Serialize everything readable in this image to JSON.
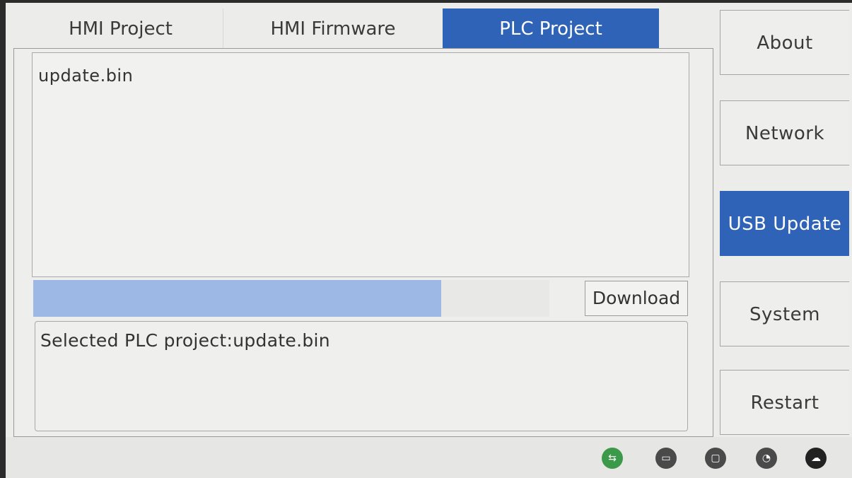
{
  "tabs": [
    {
      "label": "HMI Project",
      "active": false
    },
    {
      "label": "HMI Firmware",
      "active": false
    },
    {
      "label": "PLC Project",
      "active": true
    }
  ],
  "file_list": {
    "items": [
      "update.bin"
    ]
  },
  "progress": {
    "fraction": 0.79
  },
  "download_label": "Download",
  "status_message": "Selected PLC project:update.bin",
  "sidebar": {
    "items": [
      {
        "label": "About",
        "active": false
      },
      {
        "label": "Network",
        "active": false
      },
      {
        "label": "USB Update",
        "active": true
      },
      {
        "label": "System",
        "active": false
      },
      {
        "label": "Restart",
        "active": false
      }
    ]
  },
  "status_icons": [
    {
      "name": "usb-icon",
      "glyph": "⇆"
    },
    {
      "name": "sd-card-icon",
      "glyph": "▭"
    },
    {
      "name": "memory-icon",
      "glyph": "▢"
    },
    {
      "name": "wifi-icon",
      "glyph": "◔"
    },
    {
      "name": "cloud-icon",
      "glyph": "☁"
    }
  ],
  "colors": {
    "accent": "#2f63b8",
    "progress_fill": "#9db8e4",
    "usb_status": "#3a9a4a"
  }
}
